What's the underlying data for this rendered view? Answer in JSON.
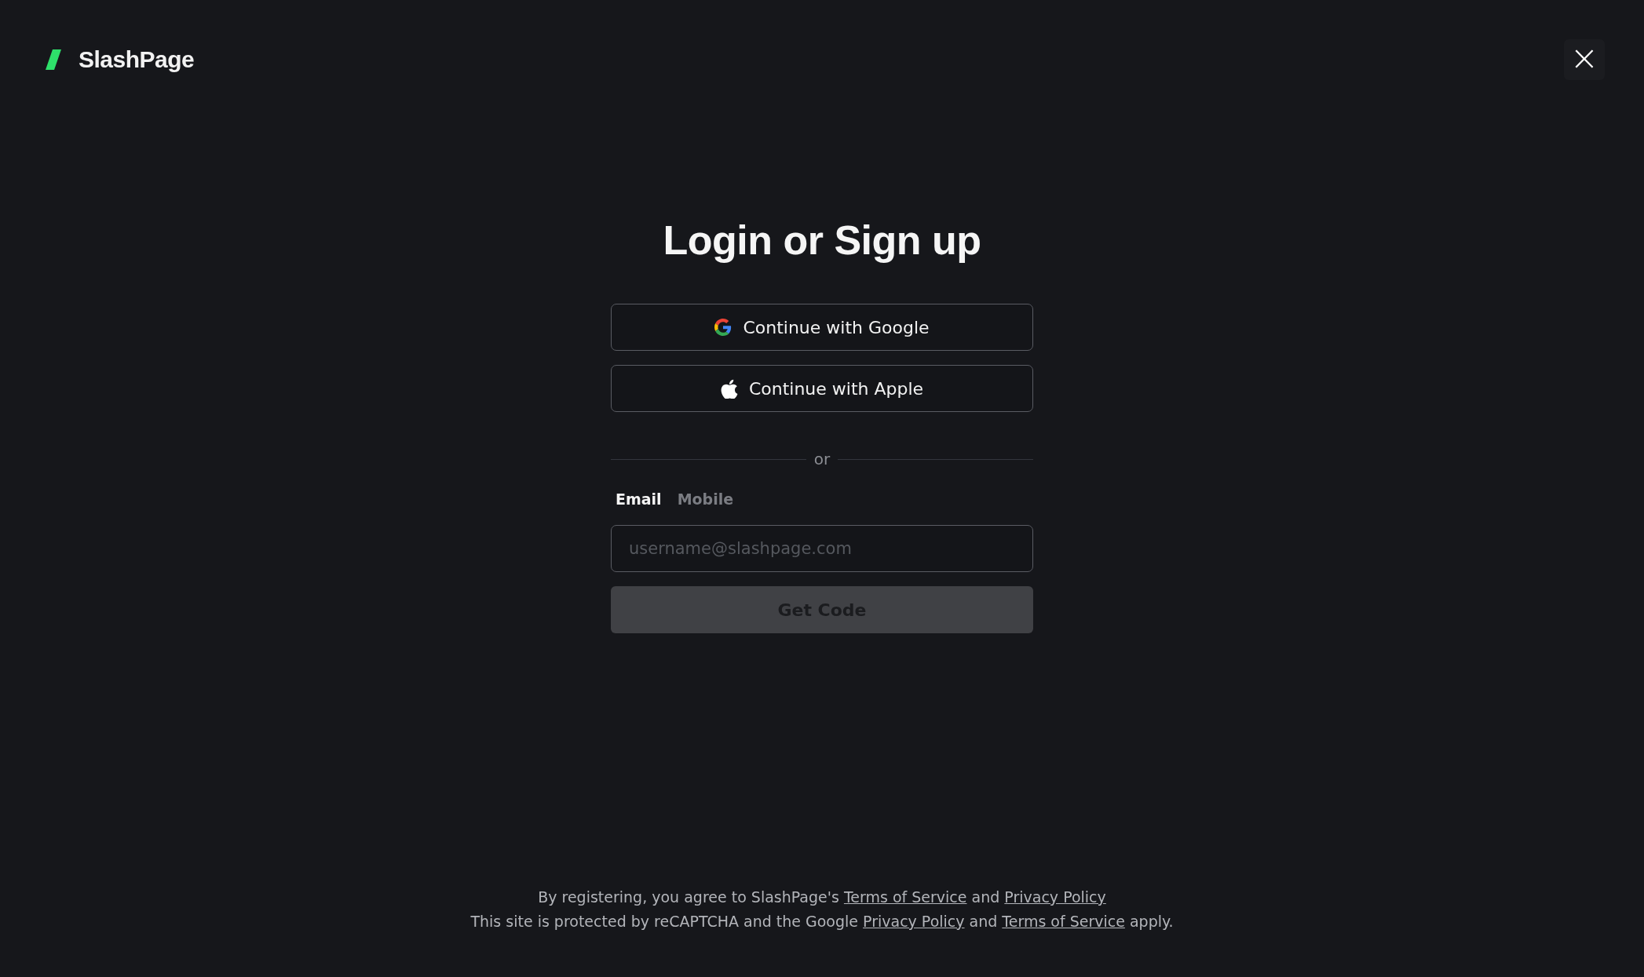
{
  "brand": {
    "name": "SlashPage"
  },
  "close": {
    "label": "×"
  },
  "title": "Login or Sign up",
  "providers": [
    {
      "kind": "google",
      "label": "Continue with Google"
    },
    {
      "kind": "apple",
      "label": "Continue with Apple"
    }
  ],
  "divider": "or",
  "tabs": [
    {
      "label": "Email",
      "selected": true
    },
    {
      "label": "Mobile",
      "selected": false
    }
  ],
  "email_field": {
    "placeholder": "username@slashpage.com"
  },
  "submit": {
    "label": "Get Code",
    "disabled": true
  },
  "footer": [
    [
      {
        "kind": "text",
        "text": "By registering, you agree to SlashPage's "
      },
      {
        "kind": "link",
        "text": "Terms of Service"
      },
      {
        "kind": "text",
        "text": " and "
      },
      {
        "kind": "link",
        "text": "Privacy Policy"
      }
    ],
    [
      {
        "kind": "text",
        "text": "This site is protected by reCAPTCHA and the Google "
      },
      {
        "kind": "link",
        "text": "Privacy Policy"
      },
      {
        "kind": "text",
        "text": " and "
      },
      {
        "kind": "link",
        "text": "Terms of Service"
      },
      {
        "kind": "text",
        "text": " apply."
      }
    ]
  ]
}
